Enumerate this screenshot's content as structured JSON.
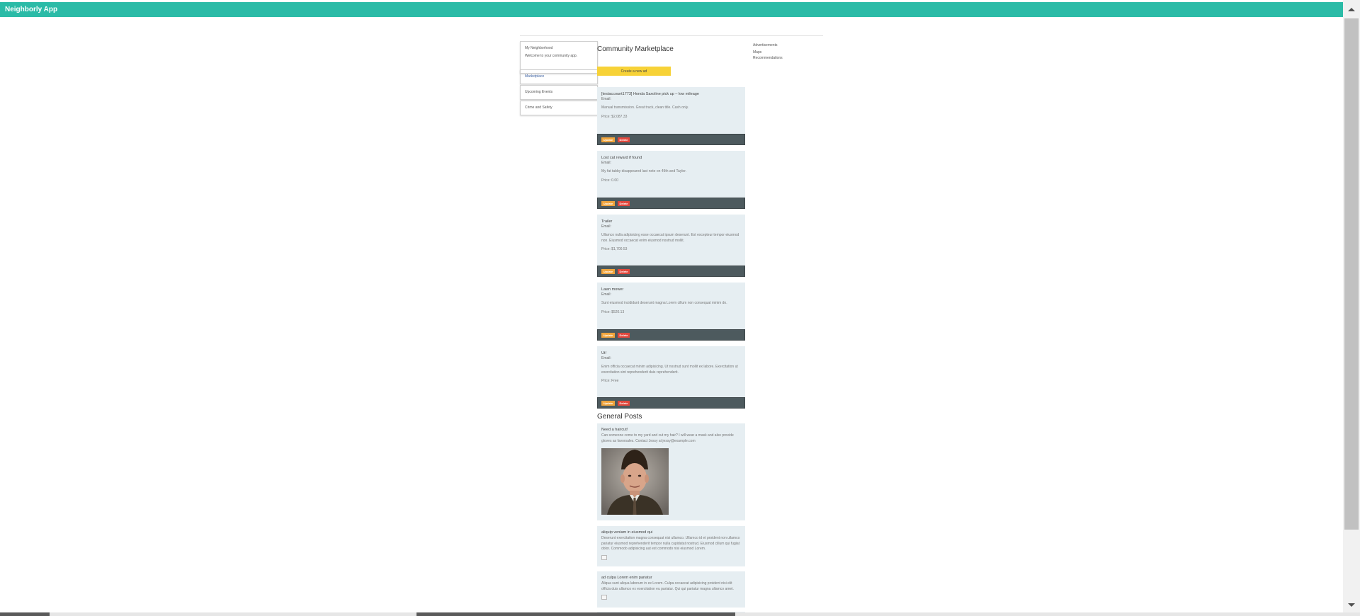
{
  "app": {
    "title": "Neighborly App"
  },
  "sidebar": {
    "neighborhood_name": "My Neighborhood",
    "welcome": "Welcome to your community app.",
    "nav": [
      {
        "label": "Marketplace",
        "active": true
      },
      {
        "label": "Upcoming Events",
        "active": false
      },
      {
        "label": "Crime and Safety",
        "active": false
      }
    ]
  },
  "right_links": [
    "Advertisements",
    "Maps",
    "Recommendations"
  ],
  "marketplace": {
    "title": "Community Marketplace",
    "create_label": "Create a new ad",
    "update_label": "Update",
    "delete_label": "Delete",
    "ads": [
      {
        "title": "[testaccount1773] Honda Saxoline pick up – low mileage",
        "email": "Email:",
        "description": "Manual transmission. Great truck, clean title. Cash only.",
        "price": "Price: $2,087.33"
      },
      {
        "title": "Lost cat reward if found",
        "email": "Email:",
        "description": "My fat tabby disappeared last note on 49th and Taylor.",
        "price": "Price: 0.00"
      },
      {
        "title": "Trailer",
        "email": "Email:",
        "description": "Ullamco nulla adipisicing esse occaecat ipsum deserunt. Est excepteur tempor eiusmod non. Eiusmod occaecat enim eiusmod nostrud mollit.",
        "price": "Price: $1,700.53"
      },
      {
        "title": "Lawn mower",
        "email": "Email:",
        "description": "Sunt eiusmod incididunt deserunt magna Lorem cillum non consequat minim do.",
        "price": "Price: $520.13"
      },
      {
        "title": "Ut!",
        "email": "Email:",
        "description": "Enim officia occaecat minim adipisicing. Ut nostrud sunt mollit ex labore. Exercitation ut exercitation sint reprehenderit duis reprehenderit.",
        "price": "Price: Free"
      }
    ]
  },
  "general": {
    "title": "General Posts",
    "posts": [
      {
        "title": "Need a haircut!",
        "text": "Can someone come to my yard and cut my hair? I will wear a mask and also provide gloves as favorsales. Contact Jessy at jessy@example.com",
        "has_photo": true
      },
      {
        "title": "aliquip veniam in eiusmod qui",
        "text": "Deserunt exercitation magna consequat nisi ullamco. Ullamco id et proident non ullamco pariatur eiusmod reprehenderit tempor nulla cupidatat nostrud. Eiusmod cillum qui fugiat dolor. Commodo adipisicing aut est commodo nisi eiusmod Lorem.",
        "has_photo": false
      },
      {
        "title": "ad culpa Lorem enim pariatur",
        "text": "Aliqua sunt aliqua laborum in ex Lorem. Culpa occaecat adipisicing proident nisi elit officia duis ullamco ex exercitation eu pariatur. Qui qui pariatur magna ullamco amet.",
        "has_photo": false
      }
    ]
  },
  "colors": {
    "topbar": "#2bbba7",
    "card": "#e6eef2",
    "toolbar": "#4d5a5e",
    "create_button": "#f7d237",
    "update_button": "#f0a43c",
    "delete_button": "#e2483d"
  }
}
